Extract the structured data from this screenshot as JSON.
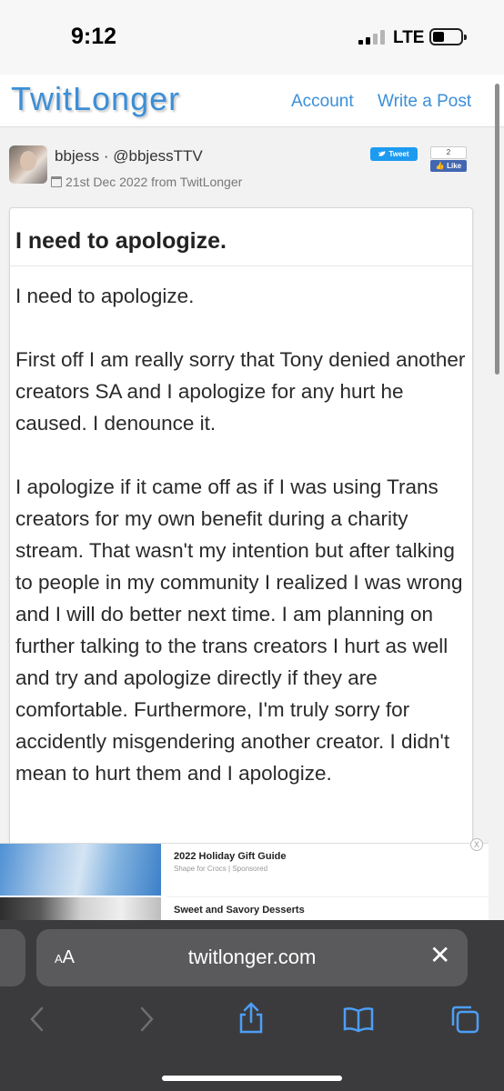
{
  "status_bar": {
    "time": "9:12",
    "network": "LTE"
  },
  "site": {
    "logo": "TwitLonger",
    "nav": {
      "account": "Account",
      "write_post": "Write a Post"
    }
  },
  "author": {
    "display": "bbjess · @bbjessTTV",
    "date": "21st Dec 2022 from TwitLonger"
  },
  "social": {
    "tweet_label": "Tweet",
    "like_count": "2",
    "like_label": "Like"
  },
  "post": {
    "title": "I need to apologize.",
    "paragraphs": [
      "I need to apologize.",
      "First off I am really sorry that Tony denied another creators SA and I apologize for any hurt he caused. I denounce it.",
      "I apologize if it came off as if I was using Trans creators for my own benefit during a charity stream. That wasn't my intention but after talking to people in my community I realized I was wrong and I will do better next time. I am planning on further talking to the trans creators I hurt as well and try and apologize directly if they are comfortable. Furthermore, I'm truly sorry for accidently misgendering another creator. I didn't mean to hurt them and I apologize."
    ]
  },
  "ad": {
    "item1_title": "2022 Holiday Gift Guide",
    "item1_sub": "Shape for Crocs | Sponsored",
    "item2_title": "Sweet and Savory Desserts",
    "close": "X"
  },
  "browser": {
    "aa_small": "A",
    "aa_large": "A",
    "url": "twitlonger.com"
  }
}
